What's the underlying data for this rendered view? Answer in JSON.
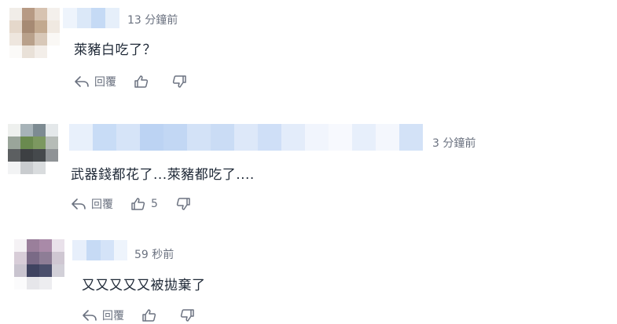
{
  "comments": [
    {
      "time": "13 分鐘前",
      "text": "萊豬白吃了？",
      "reply_label": "回覆",
      "like_count": ""
    },
    {
      "time": "3 分鐘前",
      "text": "武器錢都花了...萊豬都吃了....",
      "reply_label": "回覆",
      "like_count": "5"
    },
    {
      "time": "59 秒前",
      "text": "又又又又又被拋棄了",
      "reply_label": "回覆",
      "like_count": ""
    }
  ],
  "icons": {
    "reply": "reply-arrow-icon",
    "like": "thumbs-up-icon",
    "dislike": "thumbs-down-icon"
  },
  "colors": {
    "action_gray": "#6b7280",
    "name_blur_blue": "#c7dbf5"
  }
}
